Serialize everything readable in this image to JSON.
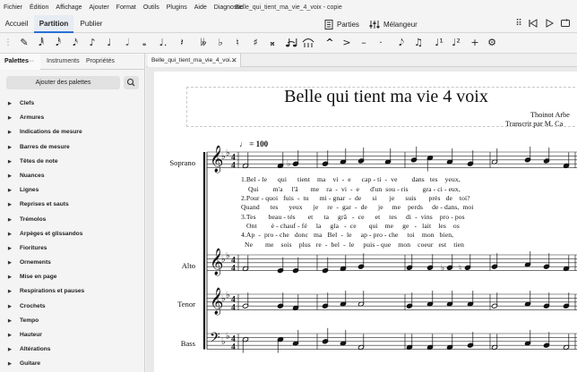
{
  "window": {
    "title": "Belle_qui_tient_ma_vie_4_voix - copie"
  },
  "menu": [
    "Fichier",
    "Édition",
    "Affichage",
    "Ajouter",
    "Format",
    "Outils",
    "Plugins",
    "Aide",
    "Diagnostic"
  ],
  "mode_tabs": {
    "home": "Accueil",
    "score": "Partition",
    "publish": "Publier"
  },
  "header_tools": {
    "parts": "Parties",
    "mixer": "Mélangeur"
  },
  "panel": {
    "tabs": [
      "Palettes",
      "Instruments",
      "Propriétés"
    ],
    "more": "···",
    "add_button": "Ajouter des palettes",
    "palettes": [
      "Clefs",
      "Armures",
      "Indications de mesure",
      "Barres de mesure",
      "Têtes de note",
      "Nuances",
      "Lignes",
      "Reprises et sauts",
      "Trémolos",
      "Arpèges et glissandos",
      "Fioritures",
      "Ornements",
      "Mise en page",
      "Respirations et pauses",
      "Crochets",
      "Tempo",
      "Hauteur",
      "Altérations",
      "Guitare"
    ]
  },
  "document": {
    "tab_label": "Belle_qui_tient_ma_vie_4_voi...",
    "title": "Belle qui tient ma vie 4 voix",
    "composer": "Thoinot Arbe",
    "arranger": "Transcrit par M. Ca",
    "tempo": "= 100",
    "instruments": [
      "Soprano",
      "Alto",
      "Tenor",
      "Bass"
    ],
    "lyrics": [
      "1.Bel - le      qui      tient    ma    vi  -  e      cap - ti  -  ve        dans   tes    yeux,",
      "    Qui        m'a     l'â       me    ra  -  vi  -  e      d'un  sou - ris        gra - ci - eux,",
      "2.Pour - quoi   fuis  -  tu      mi - gnar  -  de      si       je      suis       près   de    toi?",
      "Quand      tes      yeux      je     re  -  gar  -  de      je     me    perds     de - dans,  moi",
      "3.Tes       beau - tés       et      ta     grâ   -  ce      et     tes     di  -  vins    pro - pos",
      "   Ont        é - chauf - fé     la     gla   -  ce       qui    me     ge   -   lait    les    os",
      "4.Ap  -  pro - che   donc   ma   Bel  -  le     ap - pro - che     toi    mon   bien,",
      "  Ne       me    sois    plus   re  -  bel  -  le     puis - que    mon    coeur   est    tien"
    ]
  },
  "colors": {
    "accent": "#2a6fd6",
    "background": "#f4f4f4",
    "canvas": "#e9e9e9"
  }
}
